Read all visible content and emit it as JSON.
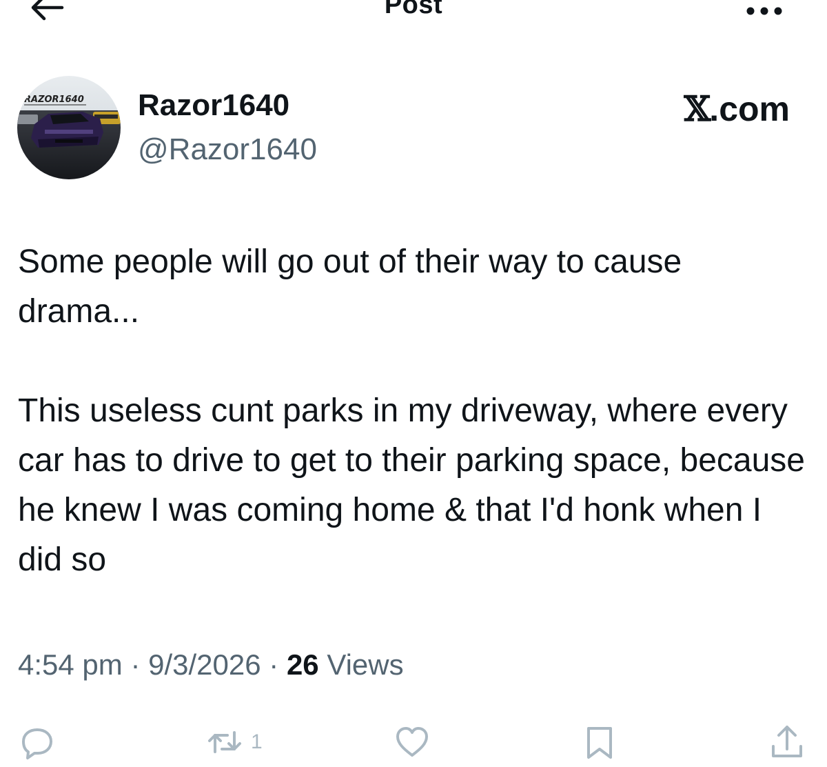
{
  "header": {
    "title": "Post",
    "back_icon": "arrow-left-icon",
    "more_icon": "more-horizontal-icon"
  },
  "author": {
    "name": "Razor1640",
    "handle": "@Razor1640",
    "avatar_text": "RAZOR1640"
  },
  "source": {
    "x_mark": "𝕏",
    "domain": ".com"
  },
  "post": {
    "paragraphs": [
      "Some people will go out of their way to cause drama...",
      "This useless cunt parks in my driveway, where every car has to drive to get to their parking space, because he knew I was coming home & that I'd honk when I did so"
    ]
  },
  "meta": {
    "time": "4:54 pm",
    "separator": "·",
    "date": "9/3/2026",
    "views_count": "26",
    "views_label": "Views"
  },
  "actions": {
    "reply": {
      "icon": "reply-icon"
    },
    "repost": {
      "icon": "repost-icon",
      "count": "1"
    },
    "like": {
      "icon": "heart-icon"
    },
    "bookmark": {
      "icon": "bookmark-icon"
    },
    "share": {
      "icon": "share-icon"
    }
  },
  "colors": {
    "text_primary": "#0f1419",
    "text_secondary": "#536471",
    "action_icon": "#aab8c2",
    "background": "#ffffff"
  }
}
